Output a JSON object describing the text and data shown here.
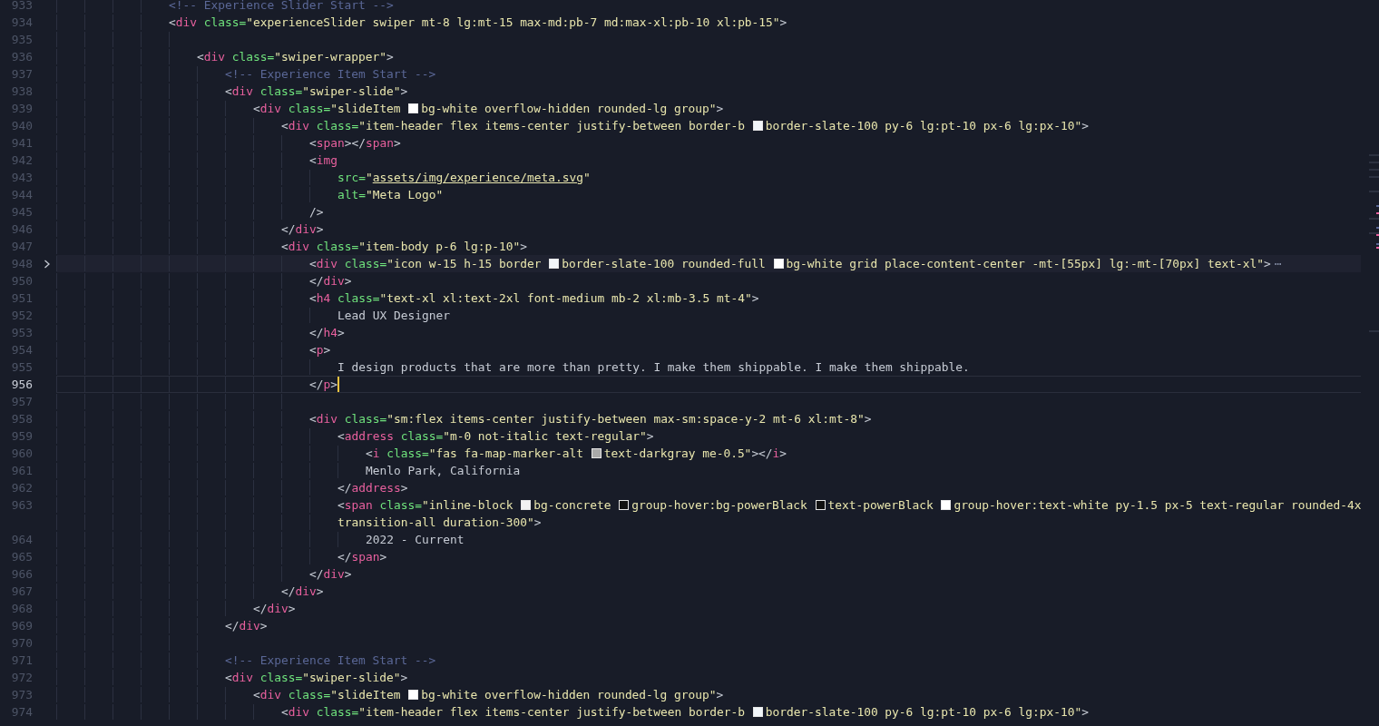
{
  "editor": {
    "lines": [
      {
        "number": "933",
        "tokens": [
          {
            "kind": "comment",
            "text": "                <!-- Experience Slider Start -->"
          }
        ]
      },
      {
        "number": "934",
        "tokens": [
          {
            "kind": "punct",
            "text": "                <"
          },
          {
            "kind": "tag",
            "text": "div"
          },
          {
            "kind": "attr",
            "text": " class="
          },
          {
            "kind": "string",
            "text": "\"experienceSlider swiper mt-8 lg:mt-15 max-md:pb-7 md:max-xl:pb-10 xl:pb-15\""
          },
          {
            "kind": "punct",
            "text": ">"
          }
        ]
      },
      {
        "number": "935"
      },
      {
        "number": "936",
        "tokens": [
          {
            "kind": "punct",
            "text": "                    <"
          },
          {
            "kind": "tag",
            "text": "div"
          },
          {
            "kind": "attr",
            "text": " class="
          },
          {
            "kind": "string",
            "text": "\"swiper-wrapper\""
          },
          {
            "kind": "punct",
            "text": ">"
          }
        ]
      },
      {
        "number": "937",
        "tokens": [
          {
            "kind": "comment",
            "text": "                        <!-- Experience Item Start -->"
          }
        ]
      },
      {
        "number": "938",
        "tokens": [
          {
            "kind": "punct",
            "text": "                        <"
          },
          {
            "kind": "tag",
            "text": "div"
          },
          {
            "kind": "attr",
            "text": " class="
          },
          {
            "kind": "string",
            "text": "\"swiper-slide\""
          },
          {
            "kind": "punct",
            "text": ">"
          }
        ]
      },
      {
        "number": "939",
        "tokens": [
          {
            "kind": "punct",
            "text": "                            <"
          },
          {
            "kind": "tag",
            "text": "div"
          },
          {
            "kind": "attr",
            "text": " class="
          },
          {
            "kind": "string",
            "text": "\"slideItem "
          },
          {
            "kind": "swatch",
            "color": "#ffffff"
          },
          {
            "kind": "string",
            "text": "bg-white overflow-hidden rounded-lg group\""
          },
          {
            "kind": "punct",
            "text": ">"
          }
        ]
      },
      {
        "number": "940",
        "tokens": [
          {
            "kind": "punct",
            "text": "                                <"
          },
          {
            "kind": "tag",
            "text": "div"
          },
          {
            "kind": "attr",
            "text": " class="
          },
          {
            "kind": "string",
            "text": "\"item-header flex items-center justify-between border-b "
          },
          {
            "kind": "swatch",
            "color": "#f1f5f9"
          },
          {
            "kind": "string",
            "text": "border-slate-100 py-6 lg:pt-10 px-6 lg:px-10\""
          },
          {
            "kind": "punct",
            "text": ">"
          }
        ]
      },
      {
        "number": "941",
        "tokens": [
          {
            "kind": "punct",
            "text": "                                    <"
          },
          {
            "kind": "tag",
            "text": "span"
          },
          {
            "kind": "punct",
            "text": "></"
          },
          {
            "kind": "tag",
            "text": "span"
          },
          {
            "kind": "punct",
            "text": ">"
          }
        ]
      },
      {
        "number": "942",
        "tokens": [
          {
            "kind": "punct",
            "text": "                                    <"
          },
          {
            "kind": "tag",
            "text": "img"
          }
        ]
      },
      {
        "number": "943",
        "tokens": [
          {
            "kind": "attr",
            "text": "                                        src="
          },
          {
            "kind": "string",
            "text": "\""
          },
          {
            "kind": "link",
            "text": "assets/img/experience/meta.svg"
          },
          {
            "kind": "string",
            "text": "\""
          }
        ]
      },
      {
        "number": "944",
        "tokens": [
          {
            "kind": "attr",
            "text": "                                        alt="
          },
          {
            "kind": "string",
            "text": "\"Meta Logo\""
          }
        ]
      },
      {
        "number": "945",
        "tokens": [
          {
            "kind": "punct",
            "text": "                                    />"
          }
        ]
      },
      {
        "number": "946",
        "tokens": [
          {
            "kind": "punct",
            "text": "                                </"
          },
          {
            "kind": "tag",
            "text": "div"
          },
          {
            "kind": "punct",
            "text": ">"
          }
        ]
      },
      {
        "number": "947",
        "tokens": [
          {
            "kind": "punct",
            "text": "                                <"
          },
          {
            "kind": "tag",
            "text": "div"
          },
          {
            "kind": "attr",
            "text": " class="
          },
          {
            "kind": "string",
            "text": "\"item-body p-6 lg:p-10\""
          },
          {
            "kind": "punct",
            "text": ">"
          }
        ]
      },
      {
        "number": "948",
        "highlighted": true,
        "folded": true,
        "fold_marker": "⋯",
        "tokens": [
          {
            "kind": "punct",
            "text": "                                    <"
          },
          {
            "kind": "tag",
            "text": "div"
          },
          {
            "kind": "attr",
            "text": " class="
          },
          {
            "kind": "string",
            "text": "\"icon w-15 h-15 border "
          },
          {
            "kind": "swatch",
            "color": "#f1f5f9"
          },
          {
            "kind": "string",
            "text": "border-slate-100 rounded-full "
          },
          {
            "kind": "swatch",
            "color": "#ffffff"
          },
          {
            "kind": "string",
            "text": "bg-white grid place-content-center -mt-[55px] lg:-mt-[70px] text-xl\""
          },
          {
            "kind": "punct",
            "text": ">"
          }
        ]
      },
      {
        "number": "950",
        "tokens": [
          {
            "kind": "punct",
            "text": "                                    </"
          },
          {
            "kind": "tag",
            "text": "div"
          },
          {
            "kind": "punct",
            "text": ">"
          }
        ]
      },
      {
        "number": "951",
        "tokens": [
          {
            "kind": "punct",
            "text": "                                    <"
          },
          {
            "kind": "tag",
            "text": "h4"
          },
          {
            "kind": "attr",
            "text": " class="
          },
          {
            "kind": "string",
            "text": "\"text-xl xl:text-2xl font-medium mb-2 xl:mb-3.5 mt-4\""
          },
          {
            "kind": "punct",
            "text": ">"
          }
        ]
      },
      {
        "number": "952",
        "tokens": [
          {
            "kind": "text",
            "text": "                                        Lead UX Designer"
          }
        ]
      },
      {
        "number": "953",
        "tokens": [
          {
            "kind": "punct",
            "text": "                                    </"
          },
          {
            "kind": "tag",
            "text": "h4"
          },
          {
            "kind": "punct",
            "text": ">"
          }
        ]
      },
      {
        "number": "954",
        "tokens": [
          {
            "kind": "punct",
            "text": "                                    <"
          },
          {
            "kind": "tag",
            "text": "p"
          },
          {
            "kind": "punct",
            "text": ">"
          }
        ]
      },
      {
        "number": "955",
        "tokens": [
          {
            "kind": "text",
            "text": "                                        I design products that are more than pretty. I make them shippable. I make them shippable."
          }
        ]
      },
      {
        "number": "956",
        "current": true,
        "tokens": [
          {
            "kind": "punct",
            "text": "                                    </"
          },
          {
            "kind": "tag",
            "text": "p"
          },
          {
            "kind": "punct",
            "text": ">"
          }
        ]
      },
      {
        "number": "957"
      },
      {
        "number": "958",
        "tokens": [
          {
            "kind": "punct",
            "text": "                                    <"
          },
          {
            "kind": "tag",
            "text": "div"
          },
          {
            "kind": "attr",
            "text": " class="
          },
          {
            "kind": "string",
            "text": "\"sm:flex items-center justify-between max-sm:space-y-2 mt-6 xl:mt-8\""
          },
          {
            "kind": "punct",
            "text": ">"
          }
        ]
      },
      {
        "number": "959",
        "tokens": [
          {
            "kind": "punct",
            "text": "                                        <"
          },
          {
            "kind": "tag",
            "text": "address"
          },
          {
            "kind": "attr",
            "text": " class="
          },
          {
            "kind": "string",
            "text": "\"m-0 not-italic text-regular\""
          },
          {
            "kind": "punct",
            "text": ">"
          }
        ]
      },
      {
        "number": "960",
        "tokens": [
          {
            "kind": "punct",
            "text": "                                            <"
          },
          {
            "kind": "tag",
            "text": "i"
          },
          {
            "kind": "attr",
            "text": " class="
          },
          {
            "kind": "string",
            "text": "\"fas fa-map-marker-alt "
          },
          {
            "kind": "swatch",
            "color": "#a9a9a9"
          },
          {
            "kind": "string",
            "text": "text-darkgray me-0.5\""
          },
          {
            "kind": "punct",
            "text": "></"
          },
          {
            "kind": "tag",
            "text": "i"
          },
          {
            "kind": "punct",
            "text": ">"
          }
        ]
      },
      {
        "number": "961",
        "tokens": [
          {
            "kind": "text",
            "text": "                                            Menlo Park, California"
          }
        ]
      },
      {
        "number": "962",
        "tokens": [
          {
            "kind": "punct",
            "text": "                                        </"
          },
          {
            "kind": "tag",
            "text": "address"
          },
          {
            "kind": "punct",
            "text": ">"
          }
        ]
      },
      {
        "number": "963",
        "tokens": [
          {
            "kind": "punct",
            "text": "                                        <"
          },
          {
            "kind": "tag",
            "text": "span"
          },
          {
            "kind": "attr",
            "text": " class="
          },
          {
            "kind": "string",
            "text": "\"inline-block "
          },
          {
            "kind": "swatch",
            "color": "#f2f2f2"
          },
          {
            "kind": "string",
            "text": "bg-concrete "
          },
          {
            "kind": "swatch",
            "color": "#111111"
          },
          {
            "kind": "string",
            "text": "group-hover:bg-powerBlack "
          },
          {
            "kind": "swatch",
            "color": "#111111"
          },
          {
            "kind": "string",
            "text": "text-powerBlack "
          },
          {
            "kind": "swatch",
            "color": "#ffffff"
          },
          {
            "kind": "string",
            "text": "group-hover:text-white py-1.5 px-5 text-regular rounded-4x"
          }
        ],
        "wrap_tokens": [
          {
            "kind": "string",
            "text": "transition-all duration-300\""
          },
          {
            "kind": "punct",
            "text": ">"
          }
        ]
      },
      {
        "number": "964",
        "tokens": [
          {
            "kind": "text",
            "text": "                                            2022 - Current"
          }
        ]
      },
      {
        "number": "965",
        "tokens": [
          {
            "kind": "punct",
            "text": "                                        </"
          },
          {
            "kind": "tag",
            "text": "span"
          },
          {
            "kind": "punct",
            "text": ">"
          }
        ]
      },
      {
        "number": "966",
        "tokens": [
          {
            "kind": "punct",
            "text": "                                    </"
          },
          {
            "kind": "tag",
            "text": "div"
          },
          {
            "kind": "punct",
            "text": ">"
          }
        ]
      },
      {
        "number": "967",
        "tokens": [
          {
            "kind": "punct",
            "text": "                                </"
          },
          {
            "kind": "tag",
            "text": "div"
          },
          {
            "kind": "punct",
            "text": ">"
          }
        ]
      },
      {
        "number": "968",
        "tokens": [
          {
            "kind": "punct",
            "text": "                            </"
          },
          {
            "kind": "tag",
            "text": "div"
          },
          {
            "kind": "punct",
            "text": ">"
          }
        ]
      },
      {
        "number": "969",
        "tokens": [
          {
            "kind": "punct",
            "text": "                        </"
          },
          {
            "kind": "tag",
            "text": "div"
          },
          {
            "kind": "punct",
            "text": ">"
          }
        ]
      },
      {
        "number": "970"
      },
      {
        "number": "971",
        "tokens": [
          {
            "kind": "comment",
            "text": "                        <!-- Experience Item Start -->"
          }
        ]
      },
      {
        "number": "972",
        "tokens": [
          {
            "kind": "punct",
            "text": "                        <"
          },
          {
            "kind": "tag",
            "text": "div"
          },
          {
            "kind": "attr",
            "text": " class="
          },
          {
            "kind": "string",
            "text": "\"swiper-slide\""
          },
          {
            "kind": "punct",
            "text": ">"
          }
        ]
      },
      {
        "number": "973",
        "tokens": [
          {
            "kind": "punct",
            "text": "                            <"
          },
          {
            "kind": "tag",
            "text": "div"
          },
          {
            "kind": "attr",
            "text": " class="
          },
          {
            "kind": "string",
            "text": "\"slideItem "
          },
          {
            "kind": "swatch",
            "color": "#ffffff"
          },
          {
            "kind": "string",
            "text": "bg-white overflow-hidden rounded-lg group\""
          },
          {
            "kind": "punct",
            "text": ">"
          }
        ]
      },
      {
        "number": "974",
        "tokens": [
          {
            "kind": "punct",
            "text": "                                <"
          },
          {
            "kind": "tag",
            "text": "div"
          },
          {
            "kind": "attr",
            "text": " class="
          },
          {
            "kind": "string",
            "text": "\"item-header flex items-center justify-between border-b "
          },
          {
            "kind": "swatch",
            "color": "#f1f5f9"
          },
          {
            "kind": "string",
            "text": "border-slate-100 py-6 lg:pt-10 px-6 lg:px-10\""
          },
          {
            "kind": "punct",
            "text": ">"
          }
        ]
      }
    ]
  }
}
